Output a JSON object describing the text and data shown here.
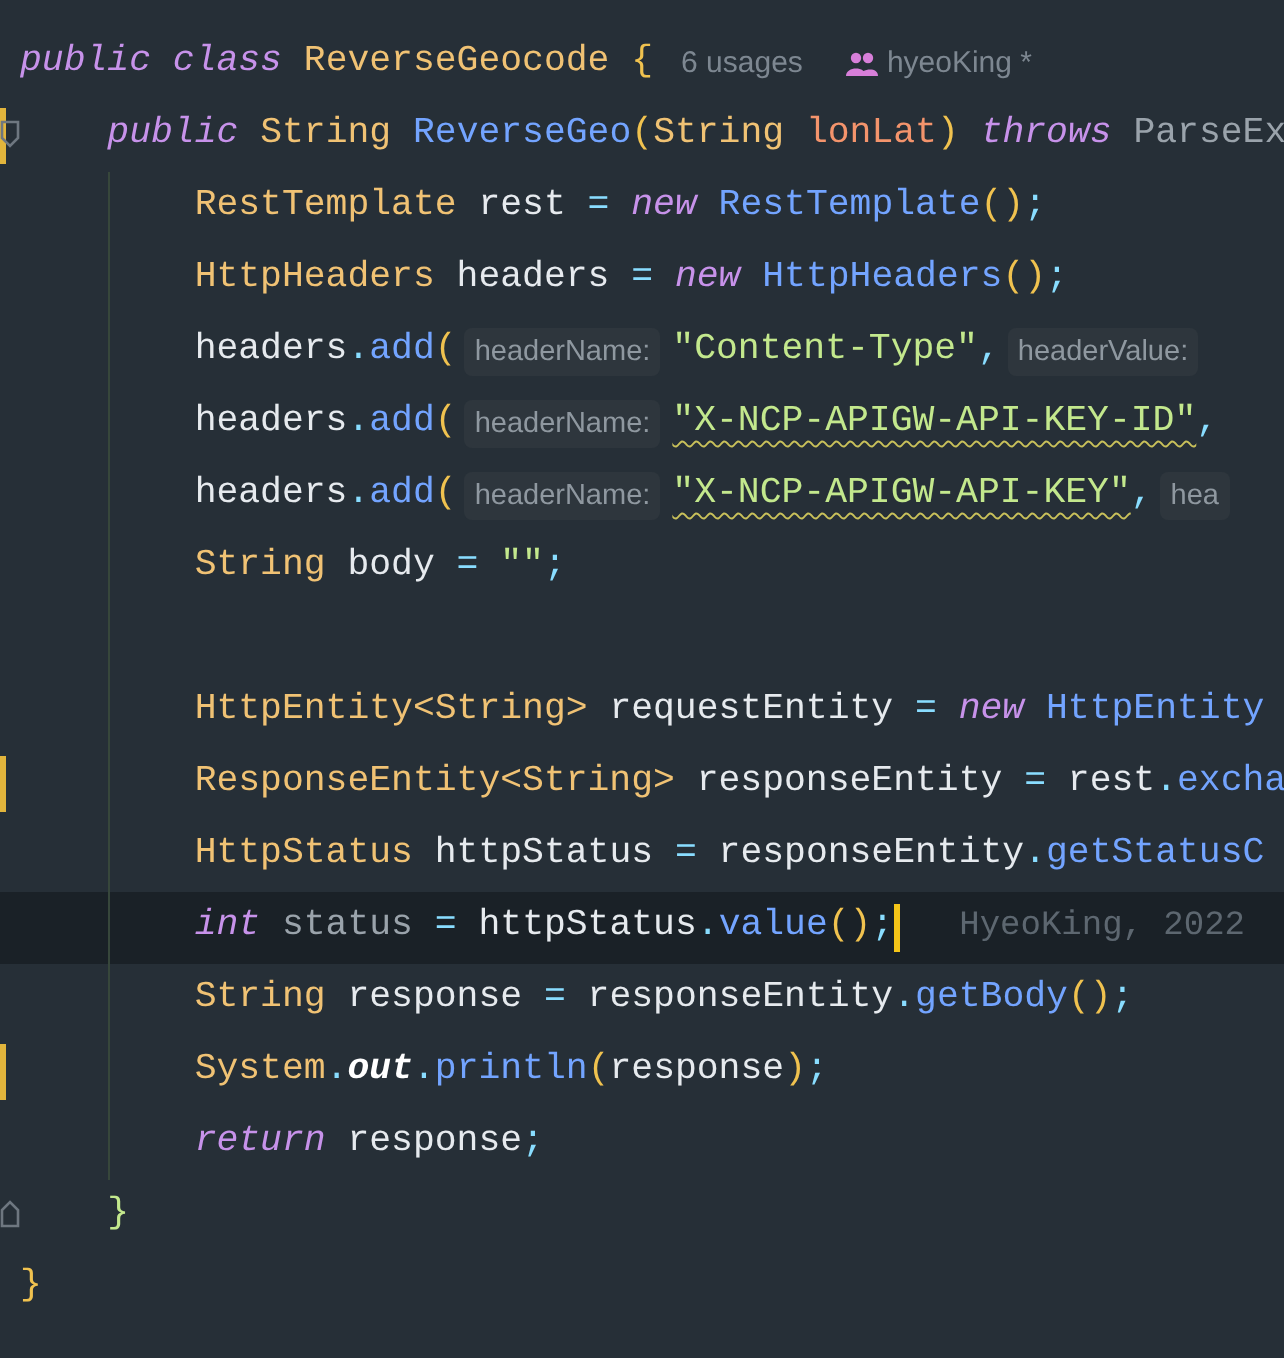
{
  "editor": {
    "lines": [
      {
        "changed": false,
        "current": false,
        "fold": false,
        "parts": [
          {
            "kind": "code",
            "tokens": [
              {
                "text": "public class",
                "kind": "keyword"
              },
              {
                "text": " ReverseGeocode ",
                "kind": "type"
              },
              {
                "text": "{",
                "kind": "brace"
              }
            ]
          },
          {
            "kind": "usages",
            "text": "6 usages"
          },
          {
            "kind": "author",
            "text": "hyeoKing *"
          }
        ],
        "children": [
          {
            "changed": true,
            "current": false,
            "fold": true,
            "parts": [
              {
                "kind": "code",
                "tokens": [
                  {
                    "text": "public",
                    "kind": "keyword"
                  },
                  {
                    "text": " String ",
                    "kind": "type"
                  },
                  {
                    "text": "ReverseGeo",
                    "kind": "method"
                  },
                  {
                    "text": "(",
                    "kind": "paren"
                  },
                  {
                    "text": "String ",
                    "kind": "type"
                  },
                  {
                    "text": "lonLat",
                    "kind": "param"
                  },
                  {
                    "text": ") ",
                    "kind": "paren"
                  },
                  {
                    "text": "throws",
                    "kind": "keyword"
                  },
                  {
                    "text": " ParseEx",
                    "kind": "muted"
                  }
                ]
              }
            ],
            "children": [
              {
                "changed": false,
                "current": false,
                "fold": false,
                "parts": [
                  {
                    "kind": "code",
                    "tokens": [
                      {
                        "text": "RestTemplate ",
                        "kind": "type"
                      },
                      {
                        "text": "rest ",
                        "kind": "plain"
                      },
                      {
                        "text": "= ",
                        "kind": "op"
                      },
                      {
                        "text": "new",
                        "kind": "keyword"
                      },
                      {
                        "text": " RestTemplate",
                        "kind": "method"
                      },
                      {
                        "text": "()",
                        "kind": "paren"
                      },
                      {
                        "text": ";",
                        "kind": "op"
                      }
                    ]
                  }
                ]
              },
              {
                "changed": false,
                "current": false,
                "fold": false,
                "parts": [
                  {
                    "kind": "code",
                    "tokens": [
                      {
                        "text": "HttpHeaders ",
                        "kind": "type"
                      },
                      {
                        "text": "headers ",
                        "kind": "plain"
                      },
                      {
                        "text": "= ",
                        "kind": "op"
                      },
                      {
                        "text": "new",
                        "kind": "keyword"
                      },
                      {
                        "text": " HttpHeaders",
                        "kind": "method"
                      },
                      {
                        "text": "()",
                        "kind": "paren"
                      },
                      {
                        "text": ";",
                        "kind": "op"
                      }
                    ]
                  }
                ]
              },
              {
                "changed": false,
                "current": false,
                "fold": false,
                "parts": [
                  {
                    "kind": "code",
                    "tokens": [
                      {
                        "text": "headers",
                        "kind": "plain"
                      },
                      {
                        "text": ".",
                        "kind": "op"
                      },
                      {
                        "text": "add",
                        "kind": "method"
                      },
                      {
                        "text": "(",
                        "kind": "paren"
                      }
                    ]
                  },
                  {
                    "kind": "hint",
                    "text": "headerName:"
                  },
                  {
                    "kind": "code",
                    "tokens": [
                      {
                        "text": "\"Content-Type\"",
                        "kind": "string"
                      },
                      {
                        "text": ",",
                        "kind": "op"
                      }
                    ]
                  },
                  {
                    "kind": "hint",
                    "text": "headerValue:"
                  }
                ]
              },
              {
                "changed": false,
                "current": false,
                "fold": false,
                "parts": [
                  {
                    "kind": "code",
                    "tokens": [
                      {
                        "text": "headers",
                        "kind": "plain"
                      },
                      {
                        "text": ".",
                        "kind": "op"
                      },
                      {
                        "text": "add",
                        "kind": "method"
                      },
                      {
                        "text": "(",
                        "kind": "paren"
                      }
                    ]
                  },
                  {
                    "kind": "hint",
                    "text": "headerName:"
                  },
                  {
                    "kind": "code",
                    "tokens": [
                      {
                        "text": "\"X-NCP-APIGW-API-KEY-ID\"",
                        "kind": "warn-string"
                      },
                      {
                        "text": ",",
                        "kind": "op"
                      }
                    ]
                  }
                ]
              },
              {
                "changed": false,
                "current": false,
                "fold": false,
                "parts": [
                  {
                    "kind": "code",
                    "tokens": [
                      {
                        "text": "headers",
                        "kind": "plain"
                      },
                      {
                        "text": ".",
                        "kind": "op"
                      },
                      {
                        "text": "add",
                        "kind": "method"
                      },
                      {
                        "text": "(",
                        "kind": "paren"
                      }
                    ]
                  },
                  {
                    "kind": "hint",
                    "text": "headerName:"
                  },
                  {
                    "kind": "code",
                    "tokens": [
                      {
                        "text": "\"X-NCP-APIGW-API-KEY\"",
                        "kind": "warn-string"
                      },
                      {
                        "text": ",",
                        "kind": "op"
                      }
                    ]
                  },
                  {
                    "kind": "hint",
                    "text": "hea"
                  }
                ]
              },
              {
                "changed": false,
                "current": false,
                "fold": false,
                "parts": [
                  {
                    "kind": "code",
                    "tokens": [
                      {
                        "text": "String ",
                        "kind": "type"
                      },
                      {
                        "text": "body ",
                        "kind": "plain"
                      },
                      {
                        "text": "= ",
                        "kind": "op"
                      },
                      {
                        "text": "\"\"",
                        "kind": "string"
                      },
                      {
                        "text": ";",
                        "kind": "op"
                      }
                    ]
                  }
                ]
              },
              {
                "changed": false,
                "current": false,
                "fold": false
              },
              {
                "changed": false,
                "current": false,
                "fold": false,
                "parts": [
                  {
                    "kind": "code",
                    "tokens": [
                      {
                        "text": "HttpEntity<String> ",
                        "kind": "type"
                      },
                      {
                        "text": "requestEntity ",
                        "kind": "plain"
                      },
                      {
                        "text": "= ",
                        "kind": "op"
                      },
                      {
                        "text": "new",
                        "kind": "keyword"
                      },
                      {
                        "text": " HttpEntity",
                        "kind": "method"
                      }
                    ]
                  }
                ]
              },
              {
                "changed": true,
                "current": false,
                "fold": false,
                "parts": [
                  {
                    "kind": "code",
                    "tokens": [
                      {
                        "text": "ResponseEntity<String> ",
                        "kind": "type"
                      },
                      {
                        "text": "responseEntity ",
                        "kind": "plain"
                      },
                      {
                        "text": "= ",
                        "kind": "op"
                      },
                      {
                        "text": "rest",
                        "kind": "plain"
                      },
                      {
                        "text": ".",
                        "kind": "op"
                      },
                      {
                        "text": "excha",
                        "kind": "method"
                      }
                    ]
                  }
                ]
              },
              {
                "changed": false,
                "current": false,
                "fold": false,
                "parts": [
                  {
                    "kind": "code",
                    "tokens": [
                      {
                        "text": "HttpStatus ",
                        "kind": "type"
                      },
                      {
                        "text": "httpStatus ",
                        "kind": "plain"
                      },
                      {
                        "text": "= ",
                        "kind": "op"
                      },
                      {
                        "text": "responseEntity",
                        "kind": "plain"
                      },
                      {
                        "text": ".",
                        "kind": "op"
                      },
                      {
                        "text": "getStatusC",
                        "kind": "method"
                      }
                    ]
                  }
                ]
              },
              {
                "changed": false,
                "current": true,
                "fold": false,
                "parts": [
                  {
                    "kind": "code",
                    "tokens": [
                      {
                        "text": "int",
                        "kind": "keyword"
                      },
                      {
                        "text": " status ",
                        "kind": "muted"
                      },
                      {
                        "text": "= ",
                        "kind": "op"
                      },
                      {
                        "text": "httpStatus",
                        "kind": "plain"
                      },
                      {
                        "text": ".",
                        "kind": "op"
                      },
                      {
                        "text": "value",
                        "kind": "method"
                      },
                      {
                        "text": "()",
                        "kind": "paren"
                      },
                      {
                        "text": ";",
                        "kind": "op"
                      }
                    ]
                  },
                  {
                    "kind": "cursor"
                  },
                  {
                    "kind": "blame",
                    "text": "HyeoKing, 2022"
                  }
                ]
              },
              {
                "changed": false,
                "current": false,
                "fold": false,
                "parts": [
                  {
                    "kind": "code",
                    "tokens": [
                      {
                        "text": "String ",
                        "kind": "type"
                      },
                      {
                        "text": "response ",
                        "kind": "plain"
                      },
                      {
                        "text": "= ",
                        "kind": "op"
                      },
                      {
                        "text": "responseEntity",
                        "kind": "plain"
                      },
                      {
                        "text": ".",
                        "kind": "op"
                      },
                      {
                        "text": "getBody",
                        "kind": "method"
                      },
                      {
                        "text": "()",
                        "kind": "paren"
                      },
                      {
                        "text": ";",
                        "kind": "op"
                      }
                    ]
                  }
                ]
              },
              {
                "changed": true,
                "current": false,
                "fold": false,
                "parts": [
                  {
                    "kind": "code",
                    "tokens": [
                      {
                        "text": "System",
                        "kind": "type"
                      },
                      {
                        "text": ".",
                        "kind": "op"
                      },
                      {
                        "text": "out",
                        "kind": "field"
                      },
                      {
                        "text": ".",
                        "kind": "op"
                      },
                      {
                        "text": "println",
                        "kind": "method"
                      },
                      {
                        "text": "(",
                        "kind": "paren"
                      },
                      {
                        "text": "response",
                        "kind": "plain"
                      },
                      {
                        "text": ")",
                        "kind": "paren"
                      },
                      {
                        "text": ";",
                        "kind": "op"
                      }
                    ]
                  }
                ]
              },
              {
                "changed": false,
                "current": false,
                "fold": false,
                "parts": [
                  {
                    "kind": "code",
                    "tokens": [
                      {
                        "text": "return",
                        "kind": "keyword"
                      },
                      {
                        "text": " response",
                        "kind": "plain"
                      },
                      {
                        "text": ";",
                        "kind": "op"
                      }
                    ]
                  }
                ]
              }
            ]
          },
          {
            "changed": false,
            "current": false,
            "fold": true,
            "parts": [
              {
                "kind": "code",
                "tokens": [
                  {
                    "text": "}",
                    "kind": "inner-brace"
                  }
                ]
              }
            ]
          }
        ]
      },
      {
        "changed": false,
        "current": false,
        "fold": false,
        "parts": [
          {
            "kind": "code",
            "tokens": [
              {
                "text": "}",
                "kind": "brace"
              }
            ]
          }
        ]
      }
    ]
  }
}
